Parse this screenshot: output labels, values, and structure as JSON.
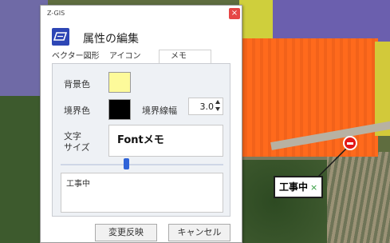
{
  "dialog": {
    "app_name": "Z-GIS",
    "close_symbol": "×",
    "title": "属性の編集",
    "tabs": [
      {
        "label": "ベクター図形"
      },
      {
        "label": "アイコン"
      },
      {
        "label": "メモ",
        "active": true
      }
    ],
    "background_color_label": "背景色",
    "background_color": "#fdfa9a",
    "border_color_label": "境界色",
    "border_color": "#000000",
    "border_width_label": "境界線幅",
    "border_width_value": "3.0",
    "font_size_label_line1": "文字",
    "font_size_label_line2": "サイズ",
    "font_preview_text": "Fontメモ",
    "font_size_slider_level": 0.4,
    "memo_text": "工事中",
    "apply_button": "変更反映",
    "cancel_button": "キャンセル"
  },
  "map": {
    "callout_text": "工事中",
    "callout_close": "×",
    "marker_color": "#e21818",
    "highlight_color": "#ff6a1c"
  }
}
